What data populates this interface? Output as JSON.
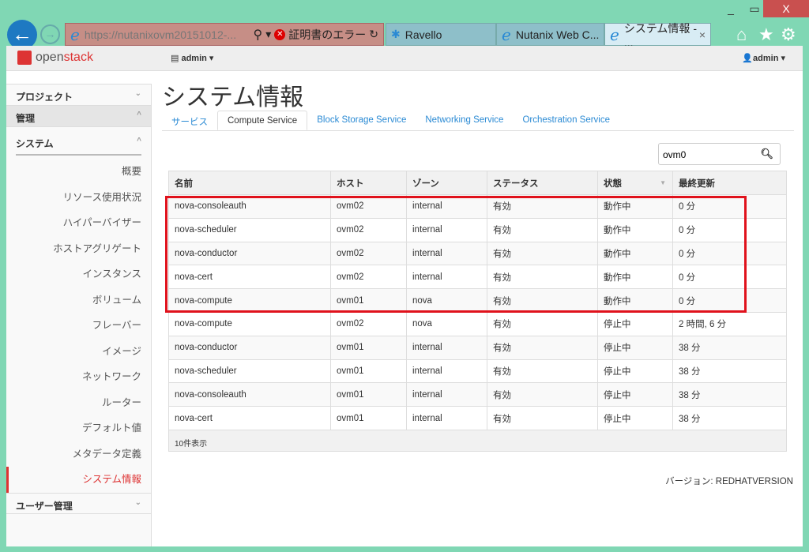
{
  "browser": {
    "url": "https://nutanixovm20151012-...",
    "cert_error": "証明書のエラー",
    "tabs": [
      {
        "label": "Ravello"
      },
      {
        "label": "Nutanix Web C..."
      },
      {
        "label": "システム情報 - ..."
      }
    ],
    "close": "X"
  },
  "header": {
    "logo": "openstack",
    "project": "admin",
    "user": "admin"
  },
  "sidebar": {
    "project": "プロジェクト",
    "admin": "管理",
    "system": "システム",
    "items": [
      "概要",
      "リソース使用状況",
      "ハイパーバイザー",
      "ホストアグリゲート",
      "インスタンス",
      "ボリューム",
      "フレーバー",
      "イメージ",
      "ネットワーク",
      "ルーター",
      "デフォルト値",
      "メタデータ定義",
      "システム情報"
    ],
    "active": "システム情報",
    "identity": "ユーザー管理"
  },
  "page": {
    "title": "システム情報",
    "tabs": [
      "サービス",
      "Compute Service",
      "Block Storage Service",
      "Networking Service",
      "Orchestration Service"
    ],
    "active_tab": "Compute Service",
    "search": "ovm0",
    "version": "バージョン: REDHATVERSION"
  },
  "table": {
    "columns": [
      "名前",
      "ホスト",
      "ゾーン",
      "ステータス",
      "状態",
      "最終更新"
    ],
    "rows": [
      [
        "nova-consoleauth",
        "ovm02",
        "internal",
        "有効",
        "動作中",
        "0 分"
      ],
      [
        "nova-scheduler",
        "ovm02",
        "internal",
        "有効",
        "動作中",
        "0 分"
      ],
      [
        "nova-conductor",
        "ovm02",
        "internal",
        "有効",
        "動作中",
        "0 分"
      ],
      [
        "nova-cert",
        "ovm02",
        "internal",
        "有効",
        "動作中",
        "0 分"
      ],
      [
        "nova-compute",
        "ovm01",
        "nova",
        "有効",
        "動作中",
        "0 分"
      ],
      [
        "nova-compute",
        "ovm02",
        "nova",
        "有効",
        "停止中",
        "2 時間, 6 分"
      ],
      [
        "nova-conductor",
        "ovm01",
        "internal",
        "有効",
        "停止中",
        "38 分"
      ],
      [
        "nova-scheduler",
        "ovm01",
        "internal",
        "有効",
        "停止中",
        "38 分"
      ],
      [
        "nova-consoleauth",
        "ovm01",
        "internal",
        "有効",
        "停止中",
        "38 分"
      ],
      [
        "nova-cert",
        "ovm01",
        "internal",
        "有効",
        "停止中",
        "38 分"
      ]
    ],
    "footer": "10件表示"
  }
}
